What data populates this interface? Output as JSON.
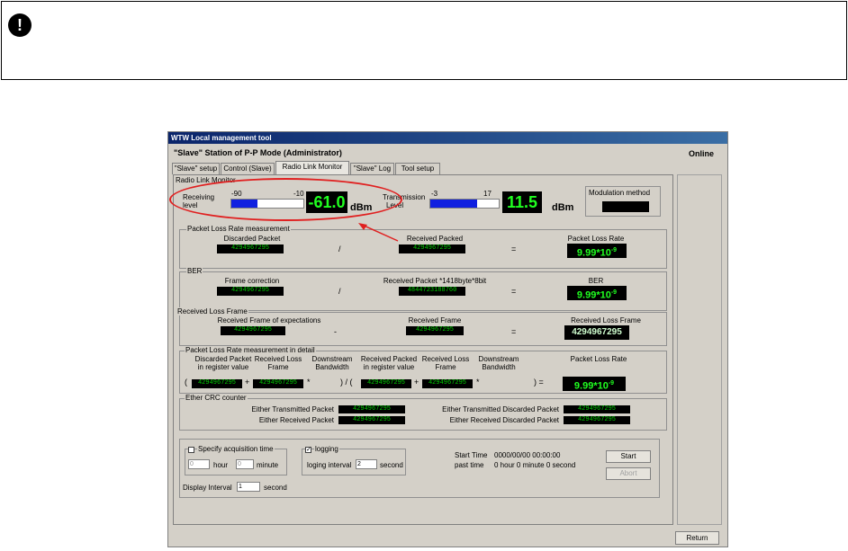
{
  "note_icon": "!",
  "window": {
    "title": "WTW Local management tool",
    "header": "\"Slave\" Station of P-P Mode (Administrator)",
    "status": "Online"
  },
  "tabs": [
    {
      "label": "\"Slave\" setup"
    },
    {
      "label": "Control (Slave)"
    },
    {
      "label": "Radio Link Monitor",
      "active": true
    },
    {
      "label": "\"Slave\" Log"
    },
    {
      "label": "Tool setup"
    }
  ],
  "monitor": {
    "title": "Radio Link Monitor",
    "receiving": {
      "label_line1": "Receiving",
      "label_line2": "level",
      "min": "-90",
      "max": "-10",
      "value": "-61.0",
      "unit": "dBm",
      "fill_fraction": 0.36
    },
    "transmission": {
      "label_line1": "Transmission",
      "label_line2": "Level",
      "min": "-3",
      "max": "17",
      "value": "11.5",
      "unit": "dBm",
      "fill_fraction": 0.68
    },
    "modulation_label": "Modulation method",
    "modulation_value": ""
  },
  "plr": {
    "title": "Packet Loss Rate measurement",
    "discarded_label": "Discarded Packet",
    "discarded_value": "4294967295",
    "received_label": "Received Packed",
    "received_value": "4294967295",
    "rate_label": "Packet Loss Rate",
    "rate_value": "9.99*10",
    "rate_exp": "-9",
    "op_div": "/",
    "op_eq": "="
  },
  "ber": {
    "title": "BER",
    "frame_label": "Frame correction",
    "frame_value": "4294967295",
    "recv_label": "Received Packet *1418byte*8bit",
    "recv_value": "4844723188760",
    "ber_label": "BER",
    "ber_value": "9.99*10",
    "ber_exp": "-9",
    "op_div": "/",
    "op_eq": "="
  },
  "rlf": {
    "title": "Received Loss Frame",
    "expect_label": "Received Frame of expectations",
    "expect_value": "4294967295",
    "recv_label": "Received Frame",
    "recv_value": "4294967295",
    "loss_label": "Received Loss Frame",
    "loss_value": "4294967295",
    "op_minus": "-",
    "op_eq": "="
  },
  "detail": {
    "title": "Packet Loss Rate measurement in detail",
    "h1a": "Discarded Packet",
    "h1b": "in register value",
    "h2a": "Received Loss",
    "h2b": "Frame",
    "h3a": "Downstream",
    "h3b": "Bandwidth",
    "h4a": "Received Packed",
    "h4b": "in register value",
    "h5a": "Received Loss",
    "h5b": "Frame",
    "h6a": "Downstream",
    "h6b": "Bandwidth",
    "h7": "Packet Loss Rate",
    "v1": "4294967295",
    "v2": "4294967295",
    "v4": "4294967295",
    "v5": "4294967295",
    "rate_value": "9.99*10",
    "rate_exp": "-9",
    "paren_open": "(",
    "plus1": "+",
    "star1": "*",
    "mid": ") / (",
    "plus2": "+",
    "star2": "*",
    "close_eq": ") ="
  },
  "ether": {
    "title": "Ether CRC counter",
    "tx_label": "Either Transmitted Packet",
    "tx_value": "4294967295",
    "rx_label": "Either Received Packet",
    "rx_value": "4294967295",
    "tx_disc_label": "Either Transmitted Discarded Packet",
    "tx_disc_value": "4294967295",
    "rx_disc_label": "Either Received Discarded Packet",
    "rx_disc_value": "4294967295"
  },
  "bottom": {
    "acq_label": "Specify acquisition time",
    "hour_value": "0",
    "hour_label": "hour",
    "minute_value": "0",
    "minute_label": "minute",
    "display_label": "Display Interval",
    "display_value": "1",
    "display_unit": "second",
    "logging_label": "logging",
    "logging_check": "✓",
    "log_interval_label": "loging interval",
    "log_interval_value": "2",
    "log_interval_unit": "second",
    "start_time_label": "Start Time",
    "start_time_value": "0000/00/00 00:00:00",
    "past_time_label": "past time",
    "past_time_value": "0 hour 0 minute 0 second",
    "start_button": "Start",
    "abort_button": "Abort",
    "return_button": "Return"
  }
}
